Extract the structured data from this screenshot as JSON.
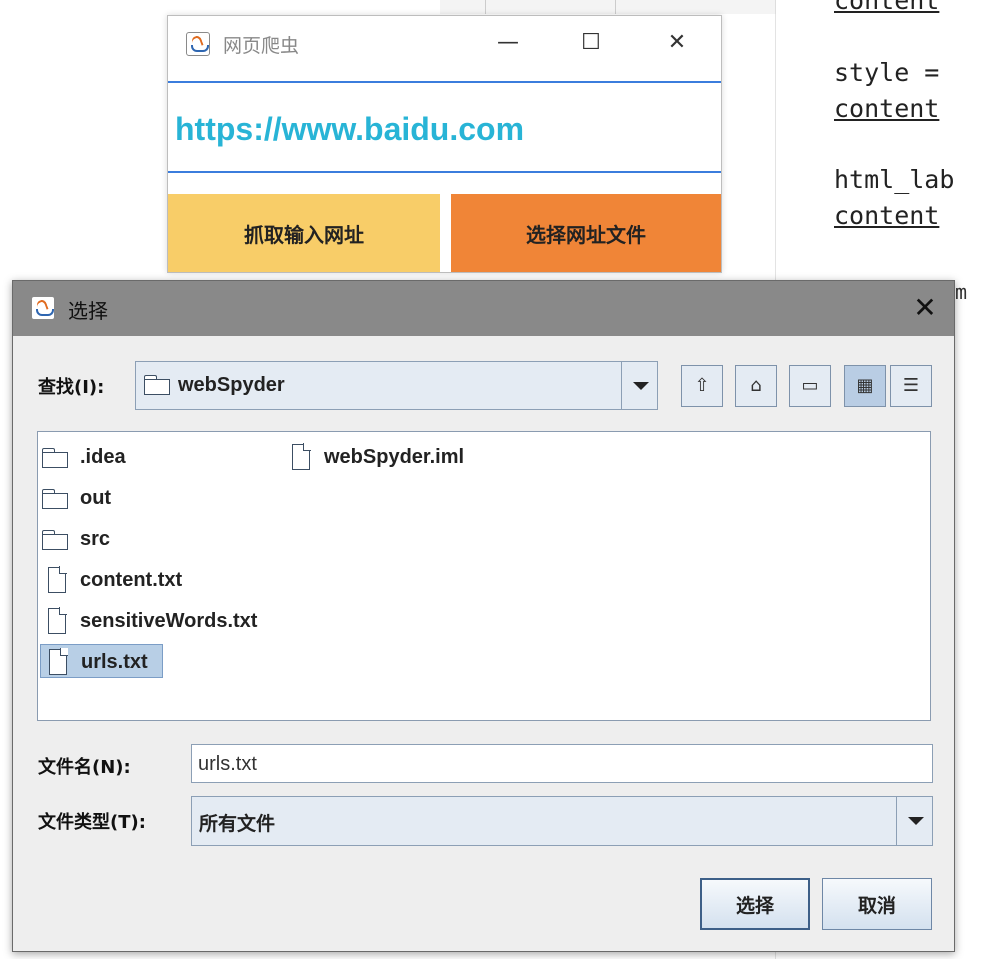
{
  "background_editor": {
    "code_lines": [
      {
        "text": "content",
        "underline": true
      },
      {
        "text": "style =",
        "underline": false
      },
      {
        "text": "content",
        "underline": true
      },
      {
        "text": "html_lab",
        "underline": false
      },
      {
        "text": "content",
        "underline": true
      }
    ]
  },
  "spider_window": {
    "title": "网页爬虫",
    "url_value": "https://www.baidu.com",
    "fetch_button": "抓取输入网址",
    "select_file_button": "选择网址文件",
    "minimize_glyph": "—",
    "maximize_glyph": "☐",
    "close_glyph": "✕"
  },
  "file_chooser": {
    "title": "选择",
    "close_glyph": "✕",
    "look_in_label": "查找(I):",
    "look_in_value": "webSpyder",
    "toolbar_icons": [
      "up-folder-icon",
      "home-icon",
      "new-folder-icon",
      "list-view-icon",
      "details-view-icon"
    ],
    "files": [
      {
        "name": ".idea",
        "type": "folder",
        "selected": false
      },
      {
        "name": "out",
        "type": "folder",
        "selected": false
      },
      {
        "name": "src",
        "type": "folder",
        "selected": false
      },
      {
        "name": "content.txt",
        "type": "file",
        "selected": false
      },
      {
        "name": "sensitiveWords.txt",
        "type": "file",
        "selected": false
      },
      {
        "name": "urls.txt",
        "type": "file",
        "selected": true
      },
      {
        "name": "webSpyder.iml",
        "type": "file",
        "selected": false
      }
    ],
    "file_name_label": "文件名(N):",
    "file_name_value": "urls.txt",
    "file_type_label": "文件类型(T):",
    "file_type_value": "所有文件",
    "approve_button": "选择",
    "cancel_button": "取消"
  },
  "colors": {
    "url_text": "#28b4d6",
    "fetch_button_bg": "#f8cd68",
    "select_button_bg": "#f08537",
    "dialog_title_bg": "#898989",
    "selection_bg": "#b8cfe6"
  }
}
